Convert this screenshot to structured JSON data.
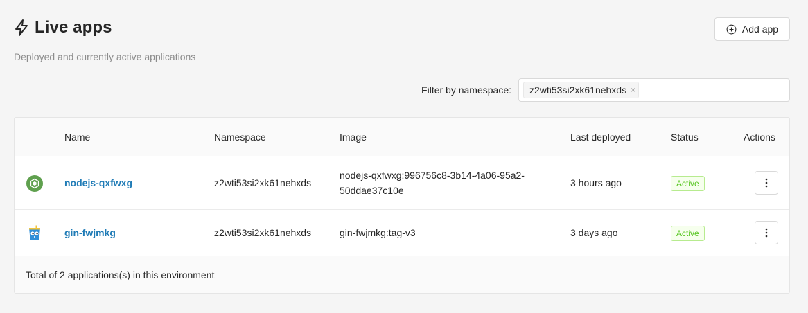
{
  "header": {
    "title": "Live apps",
    "subtitle": "Deployed and currently active applications",
    "add_button_label": "Add app"
  },
  "filter": {
    "label": "Filter by namespace:",
    "selected_tag": "z2wti53si2xk61nehxds",
    "tag_close": "×"
  },
  "table": {
    "columns": [
      "Name",
      "Namespace",
      "Image",
      "Last deployed",
      "Status",
      "Actions"
    ],
    "rows": [
      {
        "icon": "nodejs-icon",
        "name": "nodejs-qxfwxg",
        "namespace": "z2wti53si2xk61nehxds",
        "image_line1": "nodejs-qxfwxg:996756c8-3b14-4a06-95a2-",
        "image_line2": "50ddae37c10e",
        "last_deployed": "3 hours ago",
        "status": "Active"
      },
      {
        "icon": "gin-gopher-icon",
        "name": "gin-fwjmkg",
        "namespace": "z2wti53si2xk61nehxds",
        "image_line1": "gin-fwjmkg:tag-v3",
        "last_deployed": "3 days ago",
        "status": "Active"
      }
    ],
    "footer": "Total of 2 applications(s) in this environment"
  },
  "colors": {
    "link": "#1f7bb6",
    "status_green": "#52c41a",
    "nodejs_green": "#5fa04e"
  }
}
